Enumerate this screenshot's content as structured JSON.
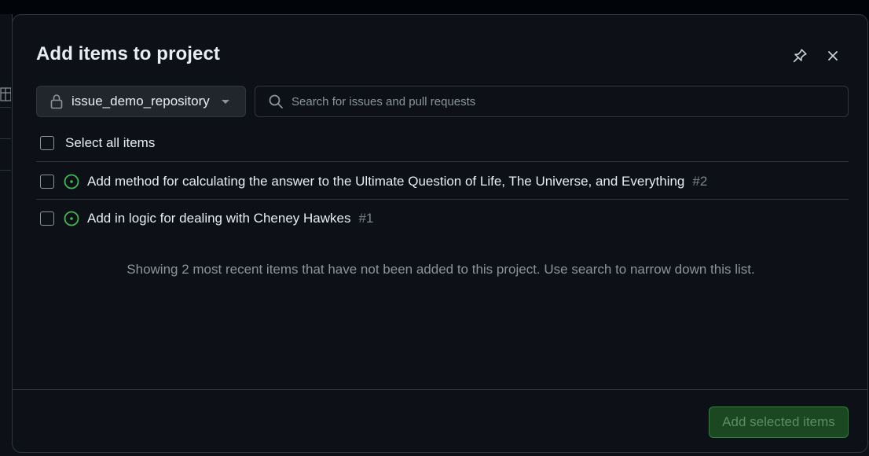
{
  "dialog": {
    "title": "Add items to project"
  },
  "repository": {
    "label": "issue_demo_repository",
    "icon": "lock-icon"
  },
  "search": {
    "placeholder": "Search for issues and pull requests",
    "value": ""
  },
  "select_all": {
    "label": "Select all items",
    "checked": false
  },
  "items": [
    {
      "title": "Add method for calculating the answer to the Ultimate Question of Life, The Universe, and Everything",
      "number": "#2",
      "status": "open-issue-icon",
      "checked": false
    },
    {
      "title": "Add in logic for dealing with Cheney Hawkes",
      "number": "#1",
      "status": "open-issue-icon",
      "checked": false
    }
  ],
  "hint": "Showing 2 most recent items that have not been added to this project. Use search to narrow down this list.",
  "footer": {
    "add_label": "Add selected items"
  },
  "colors": {
    "background": "#0d1117",
    "border": "#30363d",
    "open_issue": "#3fb950",
    "primary_button": "#1b4721"
  }
}
